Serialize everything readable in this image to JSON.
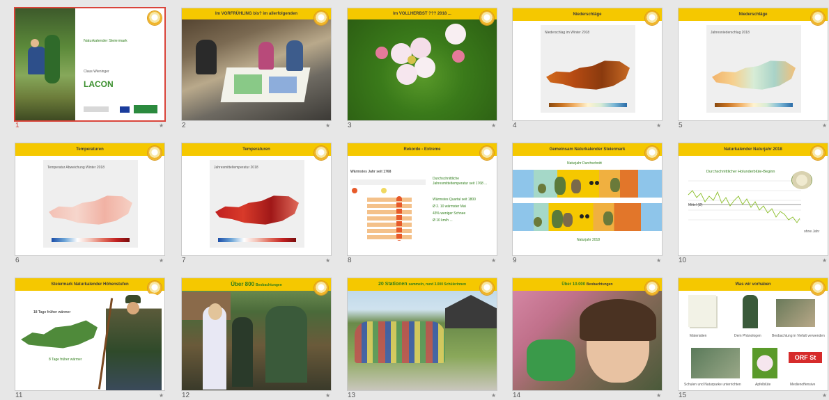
{
  "slides": [
    {
      "number": "1",
      "title": "",
      "heading": "Naturkalender Steiermark",
      "author": "Claus Wieninger",
      "logo_text": "LACON",
      "sub_logo": "",
      "selected": true
    },
    {
      "number": "2",
      "title": "Im VORFRÜHLING bis? im allerfolgenden"
    },
    {
      "number": "3",
      "title": "Im VOLLHERBST ??? 2018 ..."
    },
    {
      "number": "4",
      "title": "Niederschläge",
      "chart_title": "Niederschläge",
      "sub": "Niederschlag im Winter 2018"
    },
    {
      "number": "5",
      "title": "Niederschläge",
      "sub": "Jahresniederschlag 2018"
    },
    {
      "number": "6",
      "title": "Temperaturen",
      "sub": "Temperatur Abweichung Winter 2018"
    },
    {
      "number": "7",
      "title": "Temperaturen",
      "sub": "Jahresmitteltemperatur 2018"
    },
    {
      "number": "8",
      "title": "Rekorde - Extreme",
      "table_title": "Wärmstes Jahr seit 1768",
      "right_text": [
        "Durchschnittliche Jahresmitteltemperatur seit 1768 ...",
        "Wärmstes Quartal seit 1800",
        "Ø 2. 10 wärmster Mai",
        "43% weniger Schnee",
        "Ø 10 km/h ..."
      ]
    },
    {
      "number": "9",
      "title": "Gemeinsam Naturkalender Steiermark",
      "top_label": "Naturjahr Durchschnitt",
      "bottom_label": "Naturjahr 2018"
    },
    {
      "number": "10",
      "title": "Naturkalender Naturjahr 2018",
      "chart_title": "Durchschnittlicher Holunderblüte-Beginn",
      "y_label": "Mittel (Ø)",
      "end_label": "ohne Jahr"
    },
    {
      "number": "11",
      "title": "Steiermark Naturkalender Höhenstufen",
      "label_top": "18 Tage früher wärmer",
      "label_bottom": "8 Tage früher wärmer"
    },
    {
      "number": "12",
      "title": "Über 800 Beobachtungen",
      "title_big": "Über 800",
      "title_small": "Beobachtungen"
    },
    {
      "number": "13",
      "title": "20 Stationen sammeln, rund 3.000 Schülerinnen",
      "title_big": "20 Stationen",
      "title_small": "sammeln, rund 3.000 Schülerinnen"
    },
    {
      "number": "14",
      "title": "Über 10.000 Beobachtungen",
      "title_big": "Über 10.000",
      "title_small": "Beobachtungen"
    },
    {
      "number": "15",
      "title": "Was wir vorhaben",
      "items": [
        "Materialien",
        "Dem Phänologen",
        "Beobachtung in Viefalt verwenden",
        "Schulen und Naturparke unterrichten",
        "Apfelblüte",
        "Medienoffensive"
      ],
      "brand": "ORF St"
    }
  ],
  "colors": {
    "banner": "#f5c800",
    "selection": "#d9443a",
    "green": "#2f7d1a"
  }
}
